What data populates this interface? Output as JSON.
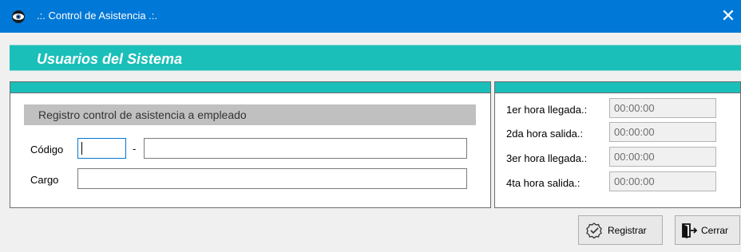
{
  "window": {
    "title": ".:. Control de Asistencia .:.",
    "close_label": "✕",
    "app_icon": "eye-icon"
  },
  "banner": {
    "title": "Usuarios del Sistema"
  },
  "colors": {
    "titlebar": "#0078d7",
    "accent": "#1abfb9",
    "section_label_bg": "#c0c0c0"
  },
  "form": {
    "section_label": "Registro control de asistencia a empleado",
    "codigo_label": "Código",
    "codigo_value": "",
    "separator": "-",
    "nombre_value": "",
    "cargo_label": "Cargo",
    "cargo_value": ""
  },
  "times": {
    "items": [
      {
        "label": "1er hora llegada.:",
        "value": "00:00:00"
      },
      {
        "label": "2da hora salida.:",
        "value": "00:00:00"
      },
      {
        "label": "3er hora llegada.:",
        "value": "00:00:00"
      },
      {
        "label": "4ta hora salida.:",
        "value": "00:00:00"
      }
    ]
  },
  "buttons": {
    "registrar_label": "Registrar",
    "registrar_icon": "check-seal-icon",
    "cerrar_label": "Cerrar",
    "cerrar_icon": "exit-door-icon"
  }
}
